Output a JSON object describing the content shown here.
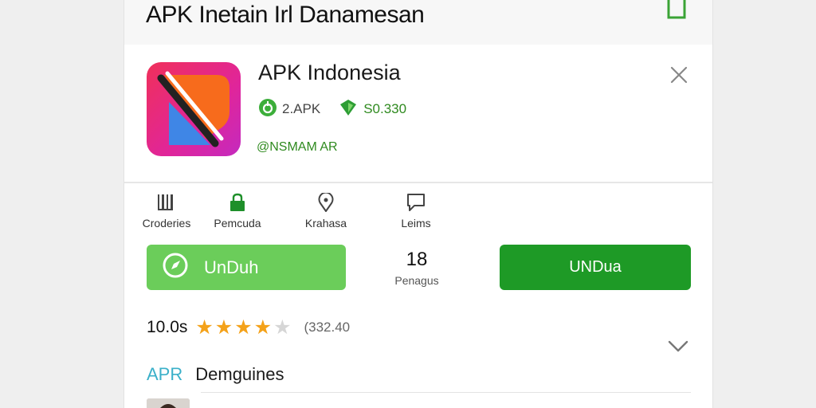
{
  "page_title": "APK Inetain Irl Danamesan",
  "app": {
    "name": "APK Indonesia",
    "version_label": "2.APK",
    "downloads_label": "S0.330",
    "developer": "@NSMAM AR"
  },
  "tabs": [
    {
      "label": "Croderies",
      "icon": "barcode-icon"
    },
    {
      "label": "Pemcuda",
      "icon": "lock-icon"
    },
    {
      "label": "Krahasa",
      "icon": "location-pin-icon"
    },
    {
      "label": "Leims",
      "icon": "comment-icon"
    }
  ],
  "primary_button": {
    "label": "UnDuh",
    "icon": "compass-icon"
  },
  "count": {
    "value": "18",
    "label": "Penagus"
  },
  "secondary_button": {
    "label": "UNDua"
  },
  "rating": {
    "value": "10.0s",
    "count": "(332.40",
    "stars": 4,
    "max_stars": 5
  },
  "section": {
    "tag": "APR",
    "title": "Demguines"
  },
  "colors": {
    "green_light": "#6bcd5a",
    "green_dark": "#1e9a26",
    "green_text": "#2f8a1f",
    "star": "#f4a21a",
    "section_tag": "#3bb0c9"
  }
}
